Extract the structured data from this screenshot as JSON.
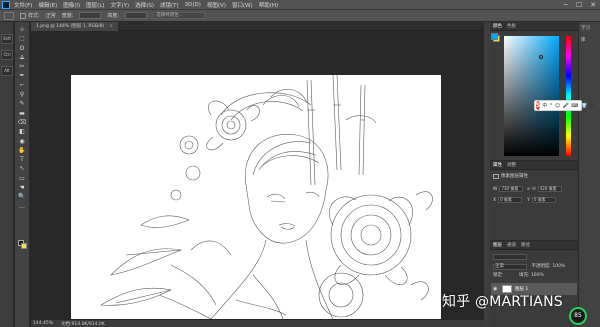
{
  "menubar": {
    "items": [
      "文件(F)",
      "编辑(E)",
      "图像(I)",
      "图层(L)",
      "文字(Y)",
      "选择(S)",
      "滤镜(T)",
      "3D(D)",
      "视图(V)",
      "窗口(W)",
      "帮助(H)"
    ],
    "window_controls": [
      "─",
      "☐",
      "✕"
    ]
  },
  "options": {
    "style_label": "样式:",
    "style_value": "正常",
    "width_label": "宽度:",
    "height_label": "高度:",
    "refine_label": "选择并遮住..."
  },
  "left_strip": [
    "Shft",
    "Ctrl",
    "Alt"
  ],
  "tools": [
    "⊹",
    "⬚",
    "ʘ",
    "⟁",
    "✂",
    "✒",
    "⌐",
    "⚲",
    "✎",
    "▬",
    "⌫",
    "◧",
    "◉",
    "✋",
    "T",
    "↖",
    "▭",
    "☚",
    "🔍",
    "…"
  ],
  "document": {
    "tab_title": "1.png @ 144% (图层 1, RGB/8)",
    "close": "×"
  },
  "panels": {
    "color_tabs": [
      "颜色",
      "色板"
    ],
    "properties_tabs": [
      "属性",
      "调整"
    ],
    "properties_title": "像素图层属性",
    "w_label": "W",
    "w_value": "730 像素",
    "h_label": "H",
    "h_value": "428 像素",
    "x_label": "X",
    "x_value": "0 像素",
    "y_label": "Y",
    "y_value": "0 像素",
    "layers_tabs": [
      "图层",
      "通道",
      "路径"
    ],
    "blend_mode": "正常",
    "opacity_label": "不透明度:",
    "opacity_value": "100%",
    "lock_label": "锁定:",
    "fill_label": "填充:",
    "fill_value": "100%",
    "layer_name": "图层 1"
  },
  "right_tools": [
    "学习",
    "库"
  ],
  "ime": {
    "logo": "S",
    "symbols": [
      "中",
      "°",
      "☺",
      "🎤",
      "⌨",
      "👕",
      "⊞"
    ]
  },
  "status": {
    "zoom": "144.45%",
    "doc": "文档:914.0K/914.0K"
  },
  "watermark": "知乎 @MARTIANS",
  "cpu_badge": "85"
}
